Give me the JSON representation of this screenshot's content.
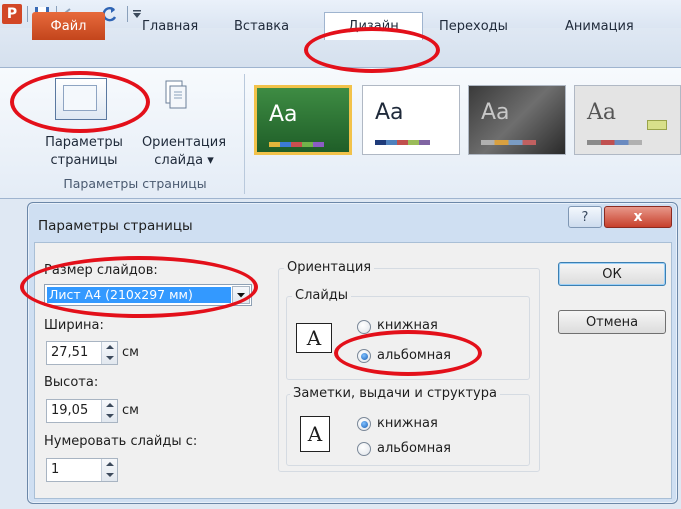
{
  "ribbon": {
    "tabs": [
      "Файл",
      "Главная",
      "Вставка",
      "Дизайн",
      "Переходы",
      "Анимация"
    ],
    "active_tab": "Дизайн",
    "page_setup_button": [
      "Параметры",
      "страницы"
    ],
    "orientation_button": [
      "Ориентация",
      "слайда ▾"
    ],
    "group_label": "Параметры страницы",
    "theme_label": "Aa"
  },
  "dialog": {
    "title": "Параметры страницы",
    "help": "?",
    "close": "x",
    "slide_size_label": "Размер слайдов:",
    "slide_size_value": "Лист А4 (210x297 мм)",
    "width_label": "Ширина:",
    "width_value": "27,51",
    "height_label": "Высота:",
    "height_value": "19,05",
    "unit": "см",
    "number_label": "Нумеровать слайды с:",
    "number_value": "1",
    "orientation_label": "Ориентация",
    "slides_label": "Слайды",
    "slides_portrait": "книжная",
    "slides_landscape": "альбомная",
    "notes_label": "Заметки, выдачи и структура",
    "notes_portrait": "книжная",
    "notes_landscape": "альбомная",
    "ok": "ОК",
    "cancel": "Отмена",
    "doc_icon_letter": "A"
  },
  "colors": {
    "highlight": "#e3101a",
    "file_tab": "#d24726"
  }
}
